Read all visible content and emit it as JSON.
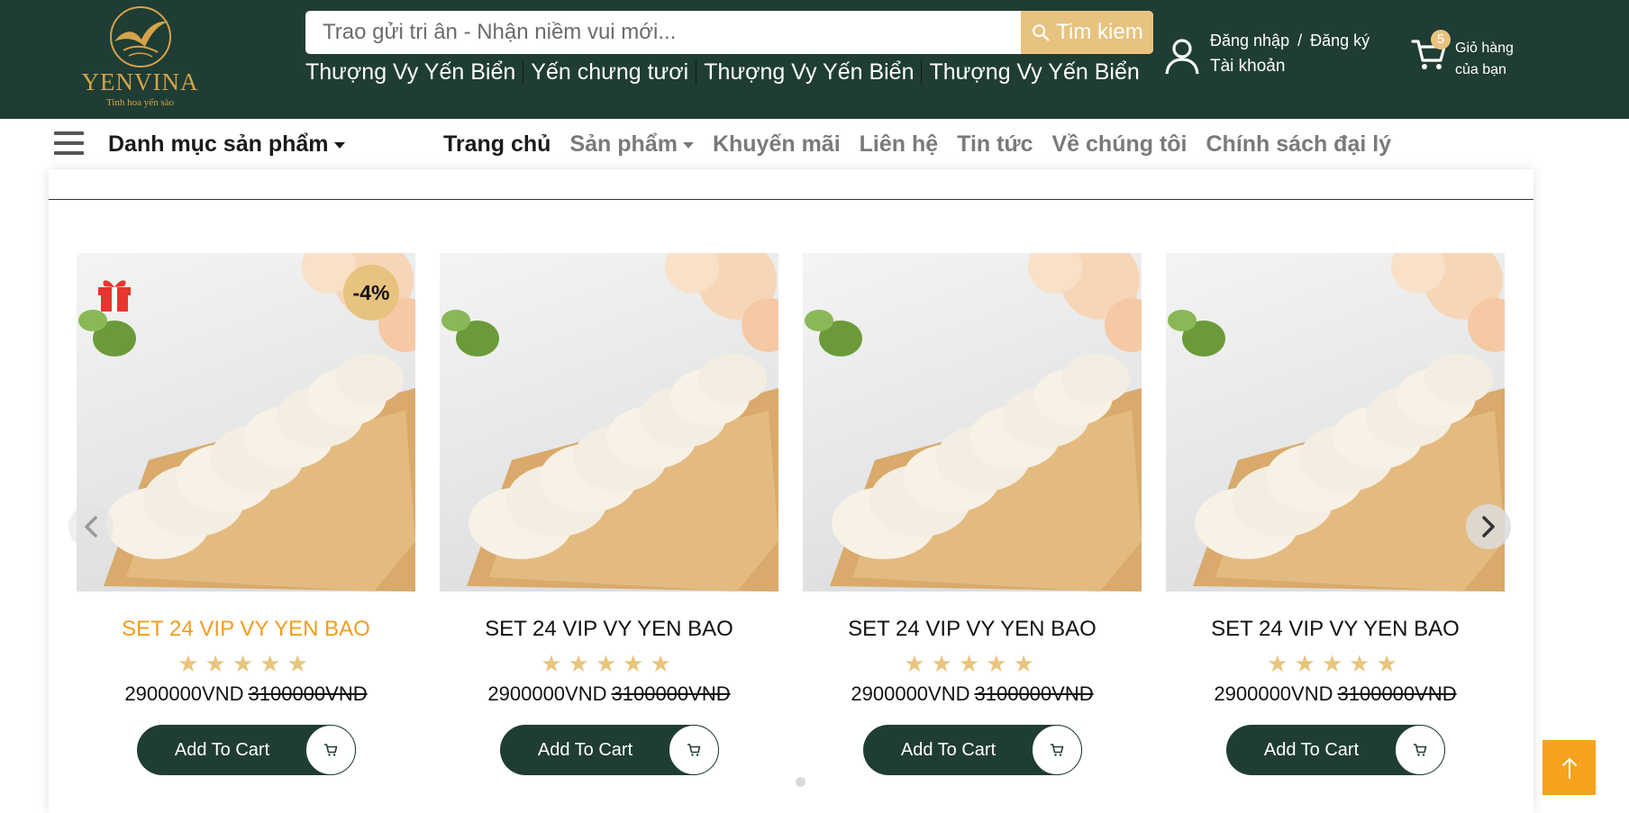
{
  "header": {
    "logo": {
      "brand": "YENVINA",
      "slogan": "Tinh hoa yến sào"
    },
    "search": {
      "placeholder": "Trao gửi tri ân - Nhận niềm vui mới...",
      "button_label": "Tim kiem"
    },
    "hot_links": [
      "Thượng Vy Yến Biển",
      "Yến chưng tươi",
      "Thượng Vy Yến Biển",
      "Thượng Vy Yến Biển"
    ],
    "account": {
      "login": "Đăng nhập",
      "separator": "/",
      "register": "Đăng ký",
      "label": "Tài khoản"
    },
    "cart": {
      "count": "5",
      "line1": "Giỏ hàng",
      "line2": "của bạn"
    }
  },
  "nav": {
    "category_menu": "Danh mục sản phẩm",
    "items": [
      {
        "label": "Trang chủ",
        "active": true
      },
      {
        "label": "Sản phẩm",
        "dropdown": true
      },
      {
        "label": "Khuyến mãi"
      },
      {
        "label": "Liên hệ"
      },
      {
        "label": "Tin tức"
      },
      {
        "label": "Về chúng tôi"
      },
      {
        "label": "Chính sách đại lý"
      }
    ]
  },
  "products": [
    {
      "title": "SET 24 VIP VY YEN BAO",
      "rating": 5,
      "stars": "★★★★★",
      "price": "2900000VND",
      "old_price": "3100000VND",
      "discount": "-4%",
      "add_to_cart": "Add To Cart"
    },
    {
      "title": "SET 24 VIP VY YEN BAO",
      "rating": 5,
      "stars": "★★★★★",
      "price": "2900000VND",
      "old_price": "3100000VND",
      "add_to_cart": "Add To Cart"
    },
    {
      "title": "SET 24 VIP VY YEN BAO",
      "rating": 5,
      "stars": "★★★★★",
      "price": "2900000VND",
      "old_price": "3100000VND",
      "add_to_cart": "Add To Cart"
    },
    {
      "title": "SET 24 VIP VY YEN BAO",
      "rating": 5,
      "stars": "★★★★★",
      "price": "2900000VND",
      "old_price": "3100000VND",
      "add_to_cart": "Add To Cart"
    }
  ],
  "colors": {
    "header_bg": "#1f3d34",
    "accent_gold": "#e8c27f",
    "highlight_orange": "#f39c1f",
    "scroll_top_bg": "#f6a21e"
  },
  "icons": [
    "search-icon",
    "user-icon",
    "cart-icon",
    "hamburger-icon",
    "gift-icon",
    "chevron-left-icon",
    "chevron-right-icon",
    "arrow-up-icon"
  ]
}
